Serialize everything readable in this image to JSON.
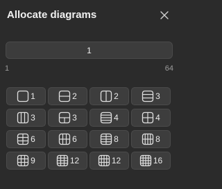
{
  "dialog": {
    "title": "Allocate diagrams",
    "close_icon": "close-icon"
  },
  "count": {
    "value": "1",
    "min_label": "1",
    "max_label": "64"
  },
  "layouts": [
    {
      "icon": "layout-single-icon",
      "count": "1"
    },
    {
      "icon": "layout-2-rows-icon",
      "count": "2"
    },
    {
      "icon": "layout-2-cols-icon",
      "count": "2"
    },
    {
      "icon": "layout-3-rows-icon",
      "count": "3"
    },
    {
      "icon": "layout-3-cols-icon",
      "count": "3"
    },
    {
      "icon": "layout-1-top-2-bottom-icon",
      "count": "3"
    },
    {
      "icon": "layout-4-rows-icon",
      "count": "4"
    },
    {
      "icon": "layout-2x2-icon",
      "count": "4"
    },
    {
      "icon": "layout-2x3-icon",
      "count": "6"
    },
    {
      "icon": "layout-3x2-icon",
      "count": "6"
    },
    {
      "icon": "layout-2x4-icon",
      "count": "8"
    },
    {
      "icon": "layout-4x2-icon",
      "count": "8"
    },
    {
      "icon": "layout-3x3-icon",
      "count": "9"
    },
    {
      "icon": "layout-3x4-icon",
      "count": "12"
    },
    {
      "icon": "layout-4x3-icon",
      "count": "12"
    },
    {
      "icon": "layout-4x4-icon",
      "count": "16"
    }
  ]
}
